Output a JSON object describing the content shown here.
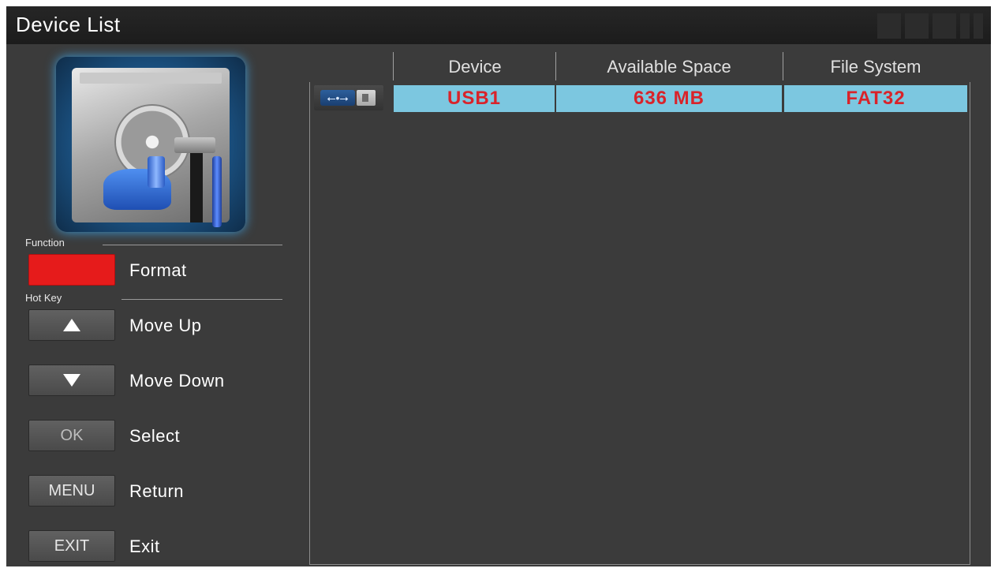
{
  "window": {
    "title": "Device List"
  },
  "sidebar": {
    "hdd_icon": "hdd-tools-icon",
    "function_label": "Function",
    "function": {
      "key_color": "#e61b1b",
      "label": "Format"
    },
    "hotkey_label": "Hot Key",
    "hotkeys": [
      {
        "key": "up-arrow-icon",
        "label": "Move Up"
      },
      {
        "key": "down-arrow-icon",
        "label": "Move Down"
      },
      {
        "key": "OK",
        "label": "Select"
      },
      {
        "key": "MENU",
        "label": "Return"
      },
      {
        "key": "EXIT",
        "label": "Exit"
      }
    ]
  },
  "table": {
    "columns": [
      "Device",
      "Available Space",
      "File System"
    ],
    "rows": [
      {
        "icon": "usb-drive-icon",
        "device": "USB1",
        "available_space": "636 MB",
        "file_system": "FAT32"
      }
    ]
  },
  "colors": {
    "selected_row": "#7cc7e0",
    "selected_text": "#d9232a",
    "background": "#3b3b3b"
  }
}
